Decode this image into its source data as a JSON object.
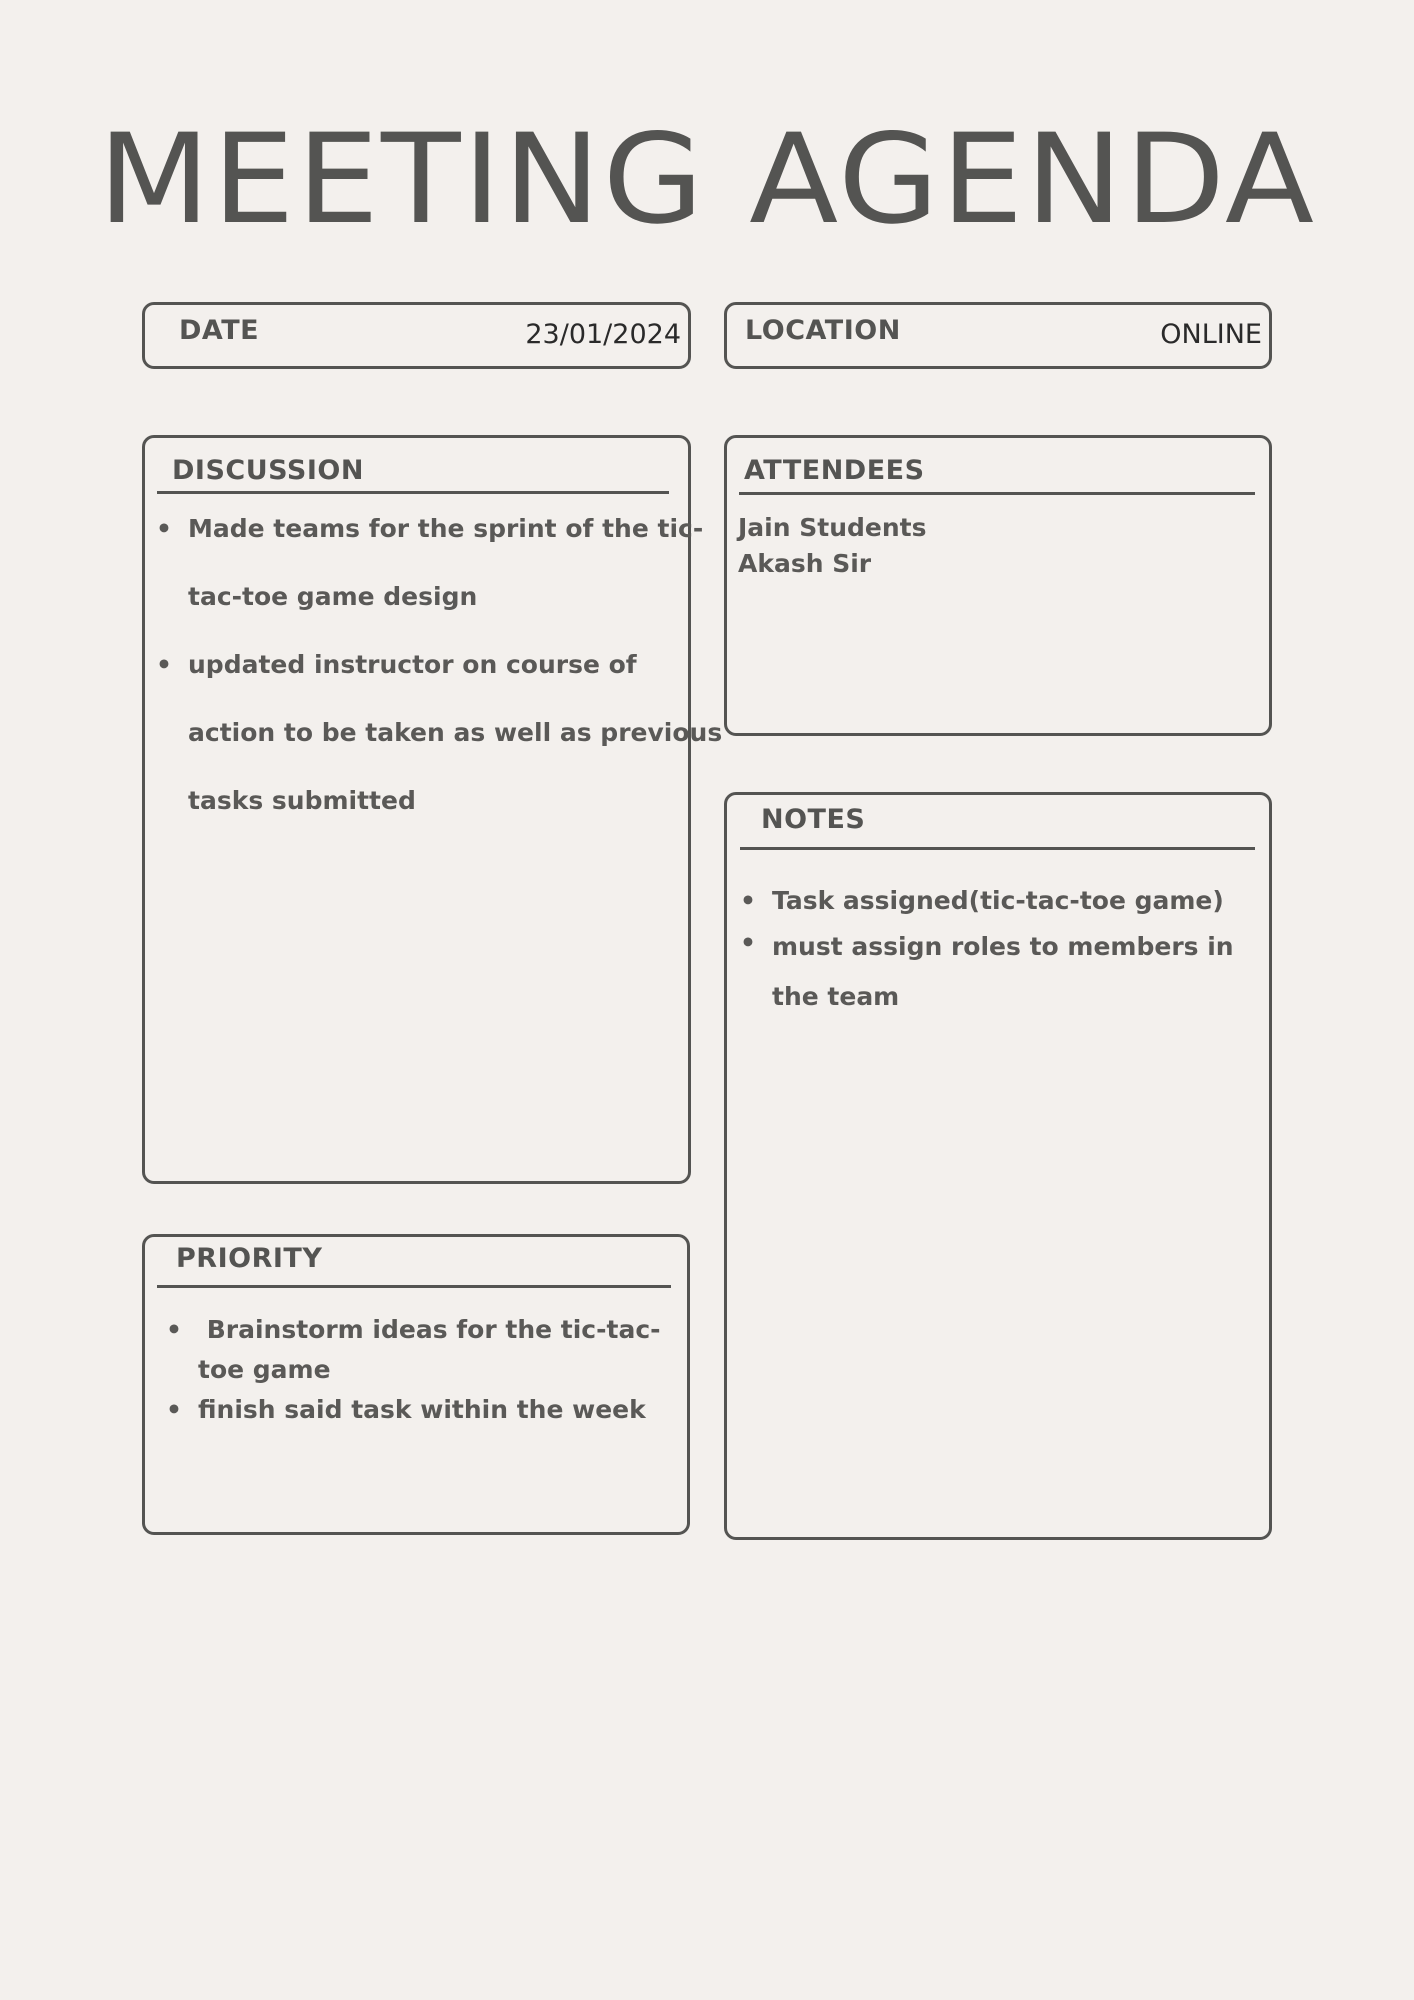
{
  "title": "MEETING AGENDA",
  "date": {
    "label": "DATE",
    "value": "23/01/2024"
  },
  "location": {
    "label": "LOCATION",
    "value": "ONLINE"
  },
  "discussion": {
    "title": "DISCUSSION",
    "items": [
      [
        "Made teams for the sprint of the tic-",
        "tac-toe game design"
      ],
      [
        "updated instructor on course of",
        "action to be taken as well as previous",
        "tasks submitted"
      ]
    ]
  },
  "attendees": {
    "title": "ATTENDEES",
    "names": [
      "Jain Students",
      "Akash Sir"
    ]
  },
  "notes": {
    "title": "NOTES",
    "items": [
      [
        "Task assigned(tic-tac-toe game)"
      ],
      [
        "must assign roles to members in",
        "the team"
      ]
    ]
  },
  "priority": {
    "title": "PRIORITY",
    "items": [
      [
        " Brainstorm ideas for the tic-tac-",
        "toe game"
      ],
      [
        "finish said task within the week"
      ]
    ]
  },
  "bullet": "•"
}
